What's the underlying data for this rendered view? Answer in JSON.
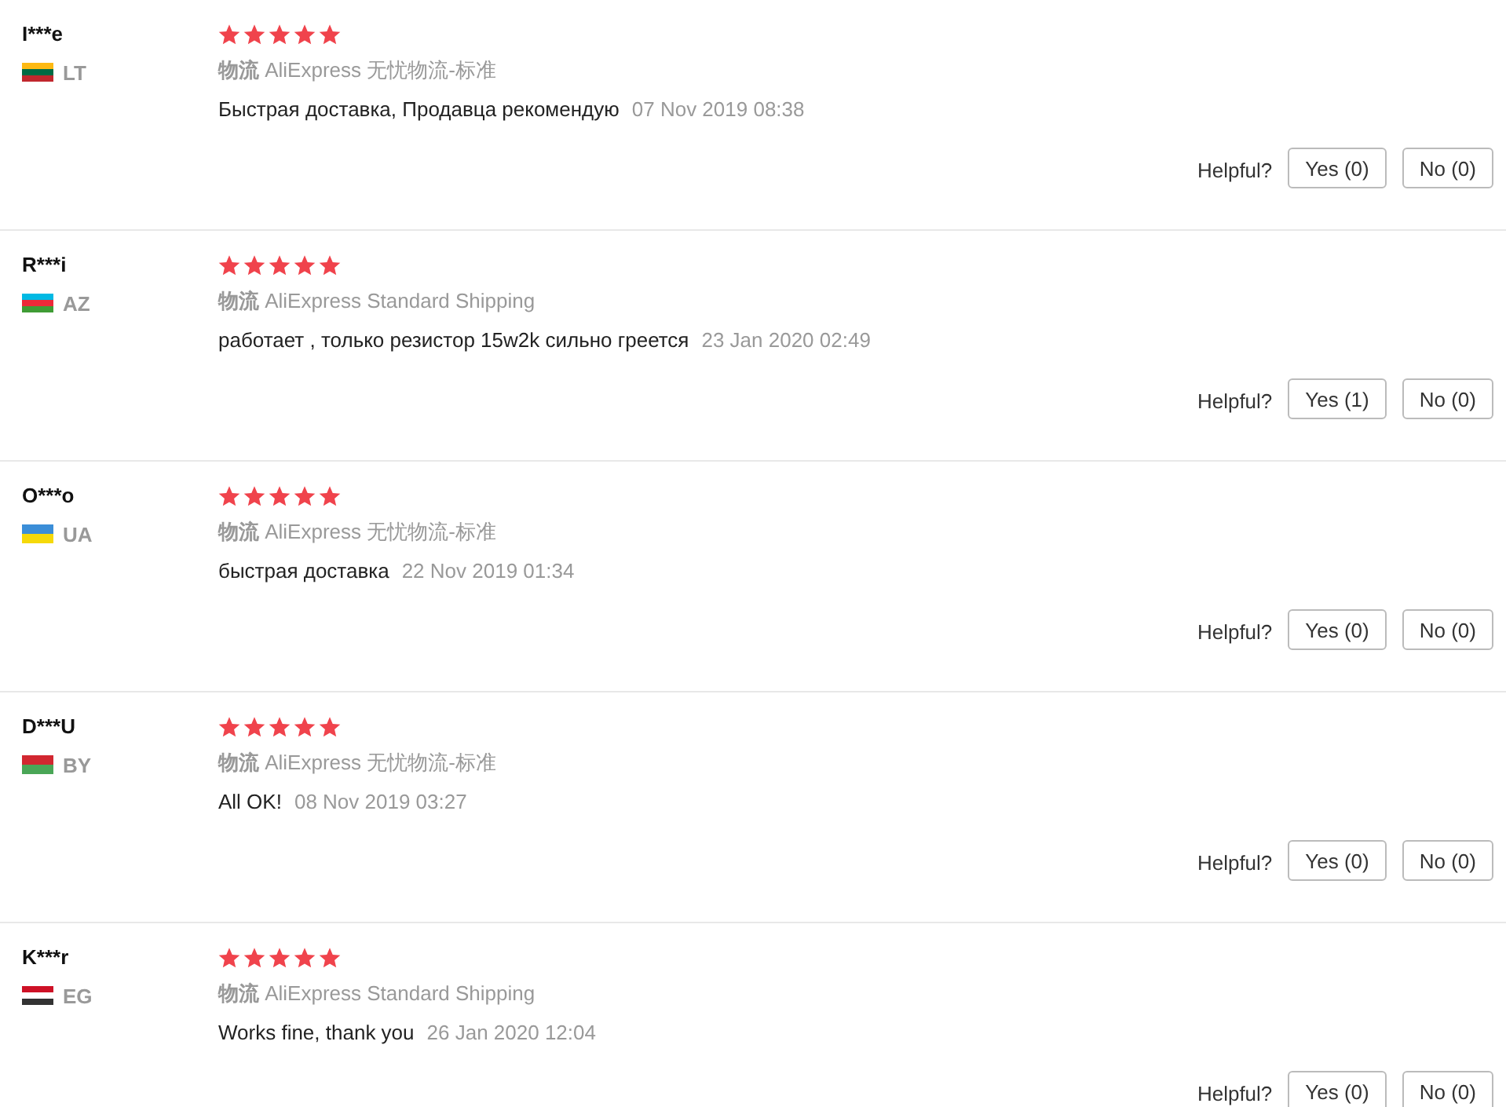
{
  "reviews": [
    {
      "name": "I***e",
      "country": "LT",
      "flag": [
        {
          "color": "#fdb913"
        },
        {
          "color": "#006a44"
        },
        {
          "color": "#c1272d"
        }
      ],
      "stars": 5,
      "shipping": "**物流** AliExpress 无忧物流-标准",
      "comment": "Быстрая доставка, Продавца рекомендую",
      "date": "07 Nov 2019 08:38",
      "helpful_label": "Helpful?",
      "yes": "Yes (0)",
      "no": "No (0)"
    },
    {
      "name": "R***i",
      "country": "AZ",
      "flag": [
        {
          "color": "#00b9e4"
        },
        {
          "color": "#ed2939"
        },
        {
          "color": "#3f9c35"
        }
      ],
      "stars": 5,
      "shipping": "**物流** AliExpress Standard Shipping",
      "comment": "работает , только резистор 15w2k сильно греется",
      "date": "23 Jan 2020 02:49",
      "helpful_label": "Helpful?",
      "yes": "Yes (1)",
      "no": "No (0)"
    },
    {
      "name": "O***o",
      "country": "UA",
      "flag": [
        {
          "color": "#3b8ed8"
        },
        {
          "color": "#f5d90a"
        }
      ],
      "stars": 5,
      "shipping": "**物流** AliExpress 无忧物流-标准",
      "comment": "быстрая доставка",
      "date": "22 Nov 2019 01:34",
      "helpful_label": "Helpful?",
      "yes": "Yes (0)",
      "no": "No (0)"
    },
    {
      "name": "D***U",
      "country": "BY",
      "flag": [
        {
          "color": "#d22730"
        },
        {
          "color": "#4aa657"
        }
      ],
      "stars": 5,
      "shipping": "**物流** AliExpress 无忧物流-标准",
      "comment": "All OK!",
      "date": "08 Nov 2019 03:27",
      "helpful_label": "Helpful?",
      "yes": "Yes (0)",
      "no": "No (0)"
    },
    {
      "name": "K***r",
      "country": "EG",
      "flag": [
        {
          "color": "#ce1126"
        },
        {
          "color": "#ffffff"
        },
        {
          "color": "#333333"
        }
      ],
      "stars": 5,
      "shipping": "**物流** AliExpress Standard Shipping",
      "comment": "Works fine, thank you",
      "date": "26 Jan 2020 12:04",
      "helpful_label": "Helpful?",
      "yes": "Yes (0)",
      "no": "No (0)"
    }
  ]
}
